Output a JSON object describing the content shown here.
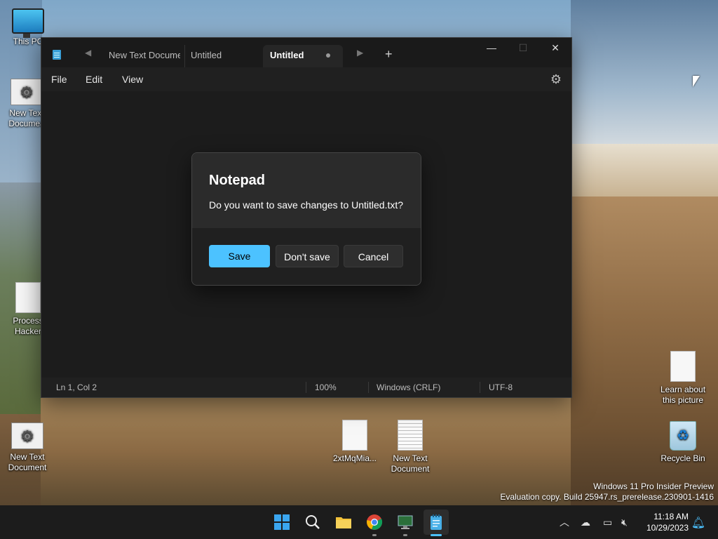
{
  "desktop": {
    "icons": [
      {
        "label": "This PC"
      },
      {
        "label": "New Text Documea"
      },
      {
        "label": "Process Hacker"
      },
      {
        "label": "New Text Document"
      },
      {
        "label": "2xtMqMia..."
      },
      {
        "label": "New Text Document"
      },
      {
        "label": "Learn about this picture"
      },
      {
        "label": "Recycle Bin"
      }
    ],
    "watermark_line1": "Windows 11 Pro Insider Preview",
    "watermark_line2": "Evaluation copy. Build 25947.rs_prerelease.230901-1416"
  },
  "notepad": {
    "tabs": [
      {
        "label": "New Text Document"
      },
      {
        "label": "Untitled"
      },
      {
        "label": "Untitled",
        "active": true,
        "unsaved": true
      }
    ],
    "new_tab_label": "+",
    "window_controls": {
      "minimize": "—",
      "maximize": "☐",
      "close": "✕"
    },
    "menu": {
      "file": "File",
      "edit": "Edit",
      "view": "View"
    },
    "status": {
      "position": "Ln 1, Col 2",
      "zoom": "100%",
      "line_ending": "Windows (CRLF)",
      "encoding": "UTF-8"
    }
  },
  "dialog": {
    "title": "Notepad",
    "message": "Do you want to save changes to Untitled.txt?",
    "save": "Save",
    "dont_save": "Don't save",
    "cancel": "Cancel"
  },
  "taskbar": {
    "time": "11:18 AM",
    "date": "10/29/2023"
  },
  "colors": {
    "accent": "#4cc2ff",
    "window_bg": "#1f1f1f"
  }
}
